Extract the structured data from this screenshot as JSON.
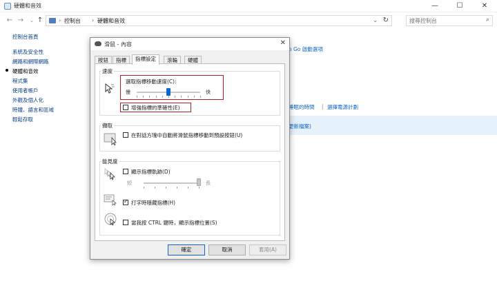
{
  "window": {
    "title": "硬體和音效"
  },
  "address": {
    "crumbs": [
      "控制台",
      "硬體和音效"
    ],
    "search_placeholder": "搜尋控制台"
  },
  "leftnav": {
    "home": "控制台首頁",
    "items": [
      "系統及安全性",
      "網路和網際網路",
      "硬體和音效",
      "程式集",
      "使用者帳戶",
      "外觀及個人化",
      "時鐘、語言和區域",
      "輕鬆存取"
    ],
    "current_index": 2
  },
  "background": {
    "link1": "o Go 啟動選項",
    "link2": "睡眠的時間",
    "sep": "|",
    "link3": "選擇電源計劃",
    "link4": "更新檔案)"
  },
  "dialog": {
    "title": "滑鼠 - 內容",
    "tabs": [
      "按鈕",
      "指標",
      "指標設定",
      "滾輪",
      "硬體"
    ],
    "active_tab": 2,
    "motion": {
      "group": "速度",
      "speed_label": "選取指標移動速度(C):",
      "slow": "慢",
      "fast": "快",
      "speed_level": 0.5,
      "precision_label": "增強指標的準確性(E)",
      "precision_checked": false
    },
    "snap": {
      "group": "擷取",
      "label": "在對話方塊中自動將滑鼠指標移動到預設按鈕(U)",
      "checked": false
    },
    "visibility": {
      "group": "能見度",
      "trails_label": "顯示指標軌跡(D)",
      "trails_checked": false,
      "short": "短",
      "long": "長",
      "trail_level": 1.0,
      "hide_label": "打字時隱藏指標(H)",
      "hide_checked": true,
      "ctrl_label": "當我按 CTRL 鍵時，顯示指標位置(S)",
      "ctrl_checked": false
    },
    "buttons": {
      "ok": "確定",
      "cancel": "取消",
      "apply": "套用(A)"
    }
  }
}
